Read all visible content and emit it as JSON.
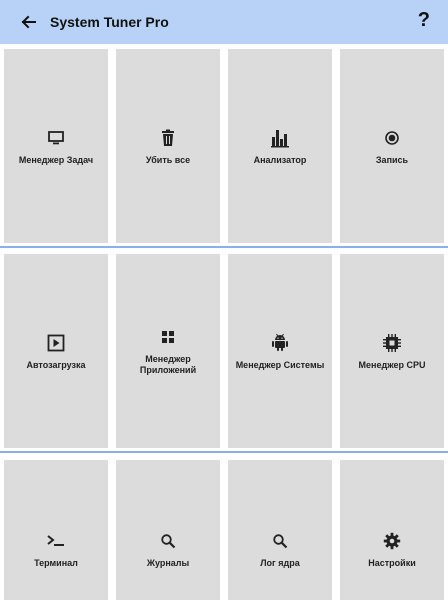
{
  "header": {
    "title": "System Tuner Pro",
    "back_icon": "arrow-left-icon",
    "help_label": "?"
  },
  "rows": [
    [
      {
        "label": "Менеджер Задач",
        "icon": "monitor-icon"
      },
      {
        "label": "Убить все",
        "icon": "trash-icon"
      },
      {
        "label": "Анализатор",
        "icon": "bar-chart-icon"
      },
      {
        "label": "Запись",
        "icon": "record-icon"
      }
    ],
    [
      {
        "label": "Автозагрузка",
        "icon": "play-box-icon"
      },
      {
        "label": "Менеджер Приложений",
        "icon": "apps-grid-icon"
      },
      {
        "label": "Менеджер Системы",
        "icon": "android-icon"
      },
      {
        "label": "Менеджер CPU",
        "icon": "cpu-chip-icon"
      }
    ],
    [
      {
        "label": "Терминал",
        "icon": "terminal-icon"
      },
      {
        "label": "Журналы",
        "icon": "search-icon"
      },
      {
        "label": "Лог ядра",
        "icon": "search-icon"
      },
      {
        "label": "Настройки",
        "icon": "gear-icon"
      }
    ]
  ],
  "colors": {
    "appbar": "#b7d2f6",
    "divider": "#87b1e8",
    "tile": "#dcdcdc"
  }
}
